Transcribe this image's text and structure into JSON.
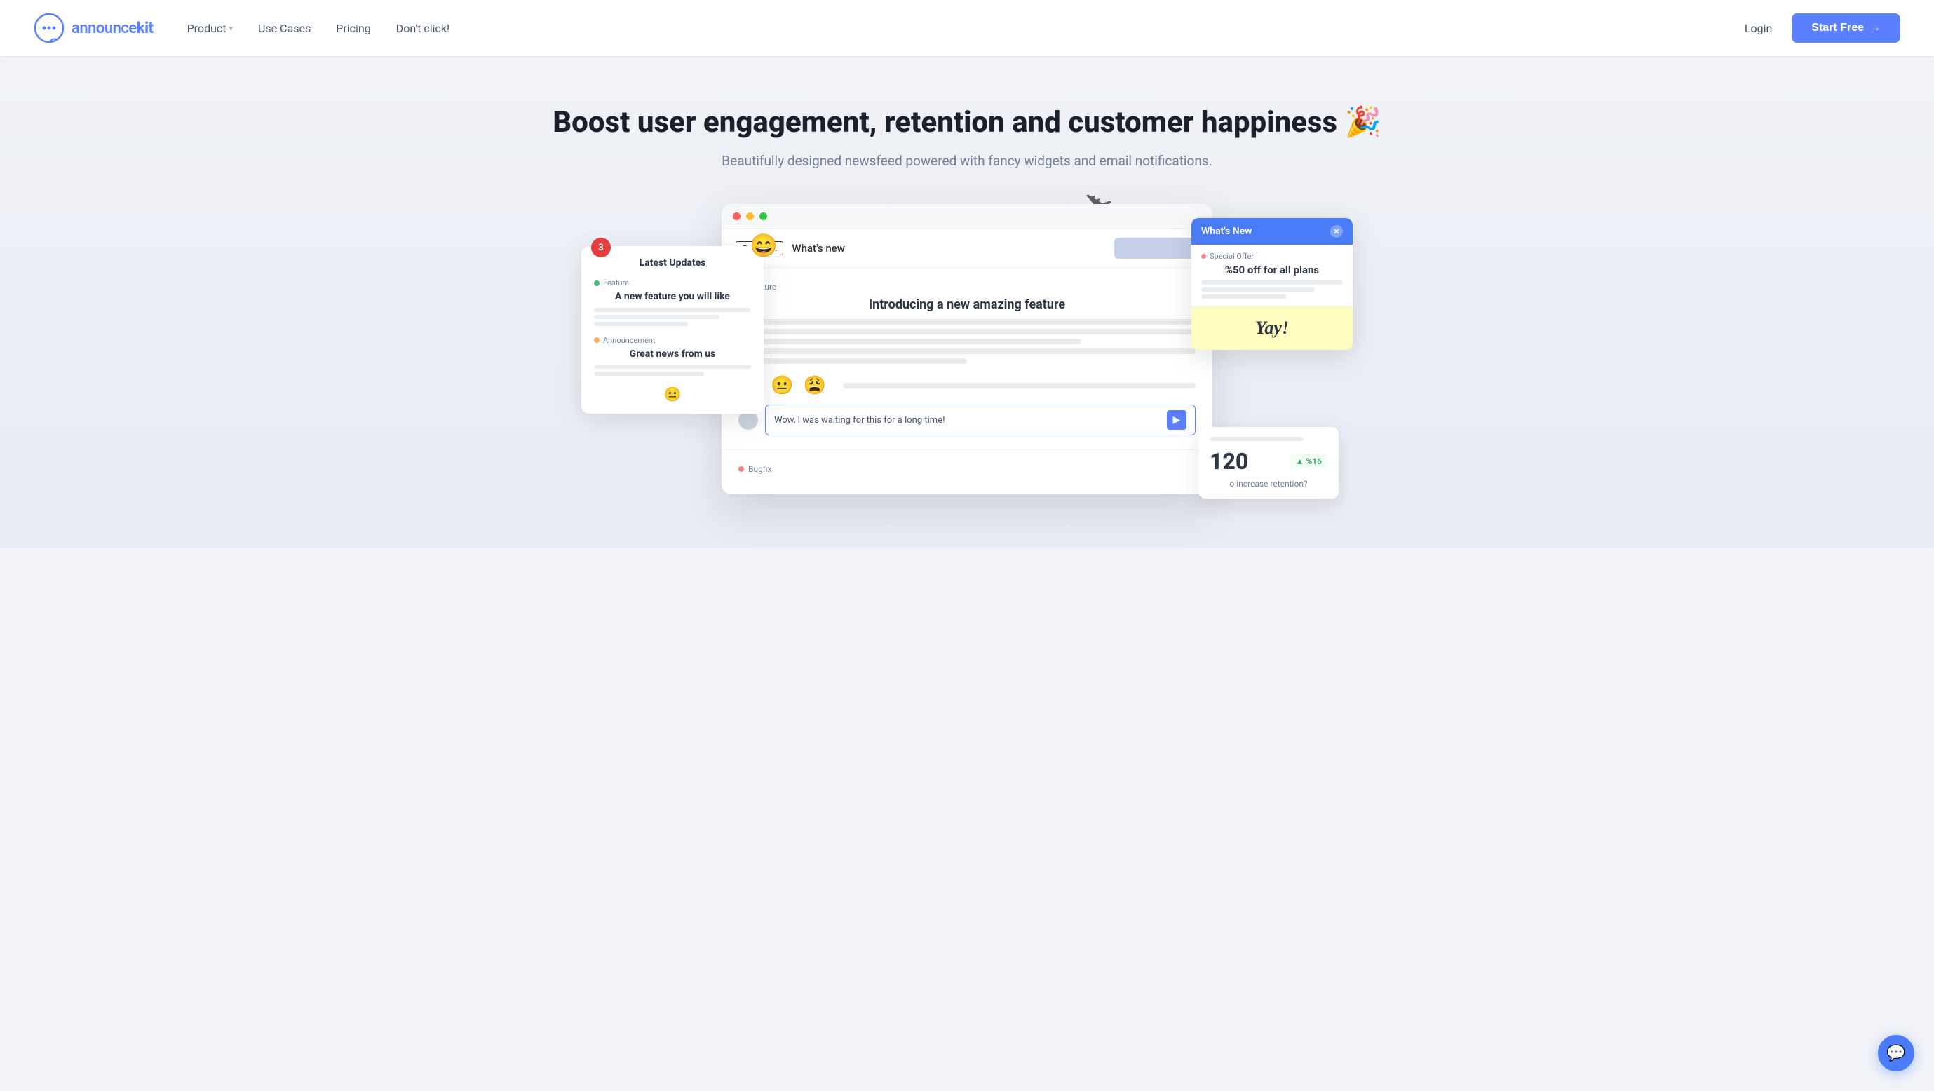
{
  "brand": {
    "name": "announcekit",
    "name_prefix": "announce",
    "name_suffix": "kit"
  },
  "navbar": {
    "product_label": "Product",
    "use_cases_label": "Use Cases",
    "pricing_label": "Pricing",
    "dont_click_label": "Don't click!",
    "login_label": "Login",
    "start_free_label": "Start Free",
    "start_free_arrow": "→"
  },
  "hero": {
    "title": "Boost user engagement, retention and customer happiness 🎉",
    "subtitle": "Beautifully designed newsfeed powered with fancy widgets and email notifications."
  },
  "browser": {
    "company_label": "Great Co.",
    "whats_new_label": "What's new",
    "post1": {
      "tag": "Feature",
      "title": "Introducing a new amazing feature",
      "comment_placeholder": "Wow, I was waiting for this for a long time!"
    },
    "post2": {
      "tag": "Bugfix"
    }
  },
  "sidebar_card": {
    "notification_count": "3",
    "title": "Latest Updates",
    "post1": {
      "tag": "Feature",
      "title": "A new feature you will like"
    },
    "post2": {
      "tag": "Announcement",
      "title": "Great news from us"
    }
  },
  "popup_card": {
    "header": "What's New",
    "offer_label": "Special Offer",
    "offer_title": "%50 off for all plans",
    "yay_text": "Yay!"
  },
  "stats_card": {
    "number": "120",
    "badge": "▲ %16",
    "question": "o increase retention?"
  },
  "reactions": {
    "emoji1": "😄",
    "emoji2": "😐",
    "emoji3": "😩"
  },
  "chat_widget": {
    "icon": "💬"
  }
}
